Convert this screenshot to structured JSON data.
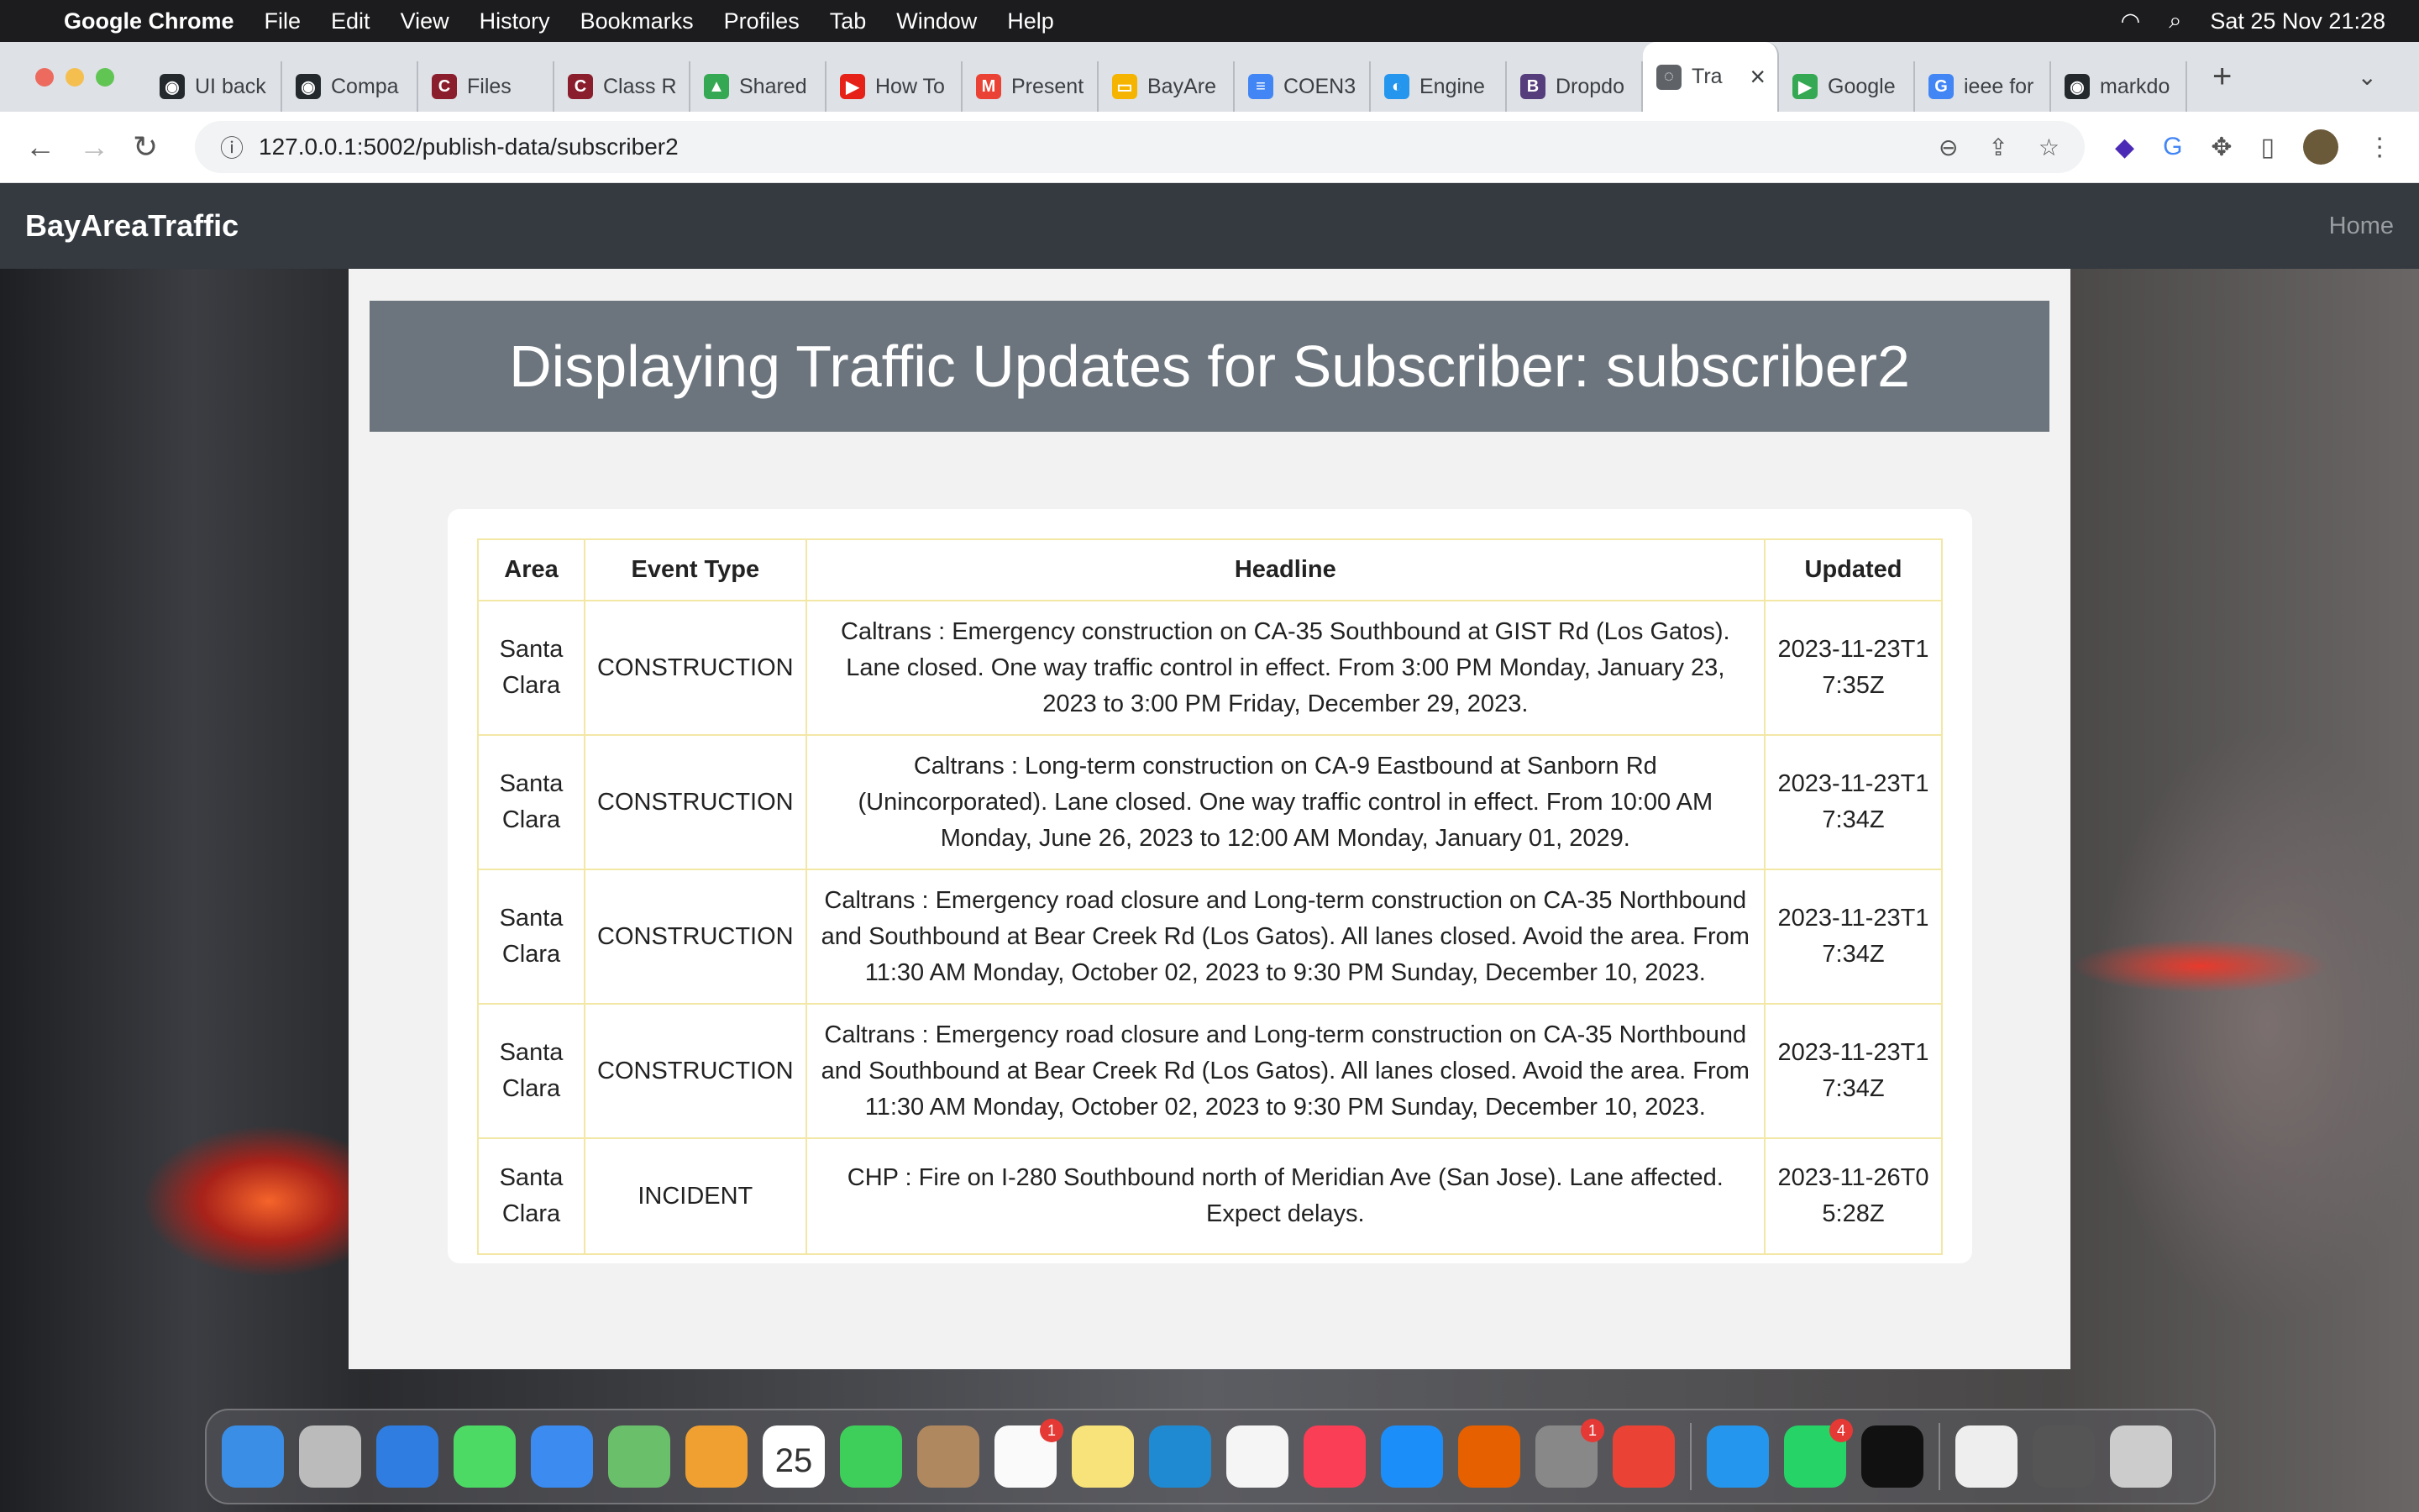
{
  "menubar": {
    "app": "Google Chrome",
    "items": [
      "File",
      "Edit",
      "View",
      "History",
      "Bookmarks",
      "Profiles",
      "Tab",
      "Window",
      "Help"
    ],
    "clock": "Sat 25 Nov  21:28"
  },
  "tabs": [
    {
      "label": "UI back",
      "color": "#24292e",
      "glyph": "◉"
    },
    {
      "label": "Compa",
      "color": "#24292e",
      "glyph": "◉"
    },
    {
      "label": "Files",
      "color": "#8b1e2d",
      "glyph": "C"
    },
    {
      "label": "Class R",
      "color": "#8b1e2d",
      "glyph": "C"
    },
    {
      "label": "Shared",
      "color": "#34a853",
      "glyph": "▲"
    },
    {
      "label": "How To",
      "color": "#e62117",
      "glyph": "▶"
    },
    {
      "label": "Present",
      "color": "#ea4335",
      "glyph": "M"
    },
    {
      "label": "BayAre",
      "color": "#f4b400",
      "glyph": "▭"
    },
    {
      "label": "COEN3",
      "color": "#4285f4",
      "glyph": "≡"
    },
    {
      "label": "Engine",
      "color": "#2496ed",
      "glyph": "◐"
    },
    {
      "label": "Dropdo",
      "color": "#563d7c",
      "glyph": "B"
    },
    {
      "label": "Tra",
      "color": "#5f6368",
      "glyph": "◌",
      "active": true,
      "close": "×"
    },
    {
      "label": "Google",
      "color": "#34a853",
      "glyph": "▶"
    },
    {
      "label": "ieee for",
      "color": "#4285f4",
      "glyph": "G"
    },
    {
      "label": "markdo",
      "color": "#24292e",
      "glyph": "◉"
    }
  ],
  "address": {
    "url": "127.0.0.1:5002/publish-data/subscriber2"
  },
  "navbar": {
    "brand": "BayAreaTraffic",
    "home": "Home"
  },
  "page": {
    "title": "Displaying Traffic Updates for Subscriber: subscriber2"
  },
  "table": {
    "headers": [
      "Area",
      "Event Type",
      "Headline",
      "Updated"
    ],
    "rows": [
      [
        "Santa Clara",
        "CONSTRUCTION",
        "Caltrans : Emergency construction on CA-35 Southbound at GIST Rd (Los Gatos). Lane closed. One way traffic control in effect. From 3:00 PM Monday, January 23, 2023 to 3:00 PM Friday, December 29, 2023.",
        "2023-11-23T17:35Z"
      ],
      [
        "Santa Clara",
        "CONSTRUCTION",
        "Caltrans : Long-term construction on CA-9 Eastbound at Sanborn Rd (Unincorporated). Lane closed. One way traffic control in effect. From 10:00 AM Monday, June 26, 2023 to 12:00 AM Monday, January 01, 2029.",
        "2023-11-23T17:34Z"
      ],
      [
        "Santa Clara",
        "CONSTRUCTION",
        "Caltrans : Emergency road closure and Long-term construction on CA-35 Northbound and Southbound at Bear Creek Rd (Los Gatos). All lanes closed. Avoid the area. From 11:30 AM Monday, October 02, 2023 to 9:30 PM Sunday, December 10, 2023.",
        "2023-11-23T17:34Z"
      ],
      [
        "Santa Clara",
        "CONSTRUCTION",
        "Caltrans : Emergency road closure and Long-term construction on CA-35 Northbound and Southbound at Bear Creek Rd (Los Gatos). All lanes closed. Avoid the area. From 11:30 AM Monday, October 02, 2023 to 9:30 PM Sunday, December 10, 2023.",
        "2023-11-23T17:34Z"
      ],
      [
        "Santa Clara",
        "INCIDENT",
        "CHP : Fire on I-280 Southbound north of Meridian Ave (San Jose). Lane affected. Expect delays.",
        "2023-11-26T05:28Z"
      ]
    ]
  },
  "dock": [
    {
      "name": "finder",
      "color": "#3a8ee6"
    },
    {
      "name": "launchpad",
      "color": "#bbb"
    },
    {
      "name": "safari",
      "color": "#2f7de1"
    },
    {
      "name": "messages",
      "color": "#4cd964"
    },
    {
      "name": "mail",
      "color": "#3b8bf0"
    },
    {
      "name": "maps",
      "color": "#6ac06a"
    },
    {
      "name": "photos",
      "color": "#f0a030"
    },
    {
      "name": "calendar",
      "color": "#ffffff",
      "text": "25"
    },
    {
      "name": "facetime",
      "color": "#3ecf5a"
    },
    {
      "name": "contacts",
      "color": "#b08860"
    },
    {
      "name": "reminders",
      "color": "#fafafa",
      "badge": "1"
    },
    {
      "name": "notes",
      "color": "#f8e27a"
    },
    {
      "name": "vscode",
      "color": "#1f8ad2"
    },
    {
      "name": "freeform",
      "color": "#f5f5f5"
    },
    {
      "name": "music",
      "color": "#fa3e55"
    },
    {
      "name": "app-store",
      "color": "#1c8ef9"
    },
    {
      "name": "firefox",
      "color": "#e66000"
    },
    {
      "name": "system-settings",
      "color": "#888",
      "badge": "1"
    },
    {
      "name": "chrome",
      "color": "#ea4335"
    },
    {
      "sep": true
    },
    {
      "name": "docker",
      "color": "#2496ed"
    },
    {
      "name": "whatsapp",
      "color": "#25d366",
      "badge": "4"
    },
    {
      "name": "terminal",
      "color": "#111"
    },
    {
      "sep": true
    },
    {
      "name": "pdf-document",
      "color": "#eee"
    },
    {
      "name": "screenshot",
      "color": "#555"
    },
    {
      "name": "trash",
      "color": "#ccc"
    }
  ]
}
